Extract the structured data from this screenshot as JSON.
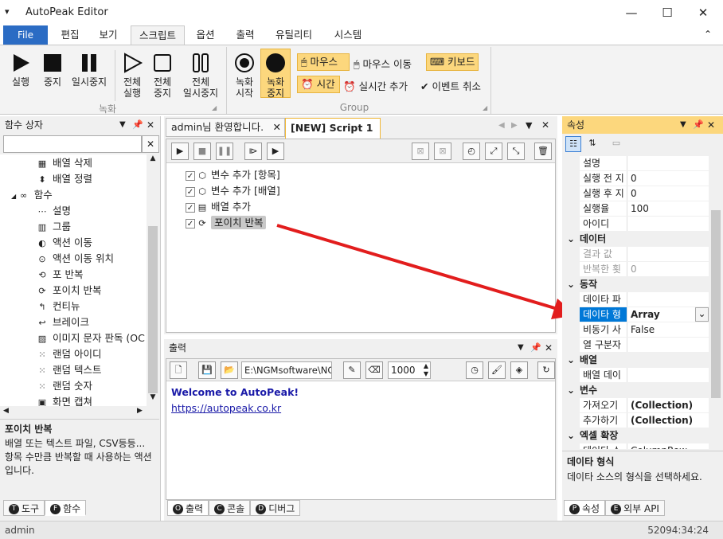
{
  "window": {
    "title": "AutoPeak Editor",
    "menu_glyph": "▾",
    "minimize": "—",
    "maximize": "☐",
    "close": "✕"
  },
  "ribbon_tabs": [
    "File",
    "편집",
    "보기",
    "스크립트",
    "옵션",
    "출력",
    "유틸리티",
    "시스템"
  ],
  "collapse_glyph": "⌃",
  "ribbon": {
    "run": "실행",
    "stop": "중지",
    "pause": "일시중지",
    "run_all": "전체\n실행",
    "stop_all": "전체\n중지",
    "pause_all": "전체\n일시중지",
    "group1": "녹화",
    "rec_start": "녹화\n시작",
    "rec_stop": "녹화\n중지",
    "mouse": "마우스",
    "mouse_move": "마우스 이동",
    "keyboard": "키보드",
    "time": "시간",
    "realtime_add": "실시간 추가",
    "event_cancel": "이벤트 취소",
    "group2": "Group"
  },
  "left_panel": {
    "title": "함수 상자",
    "search_placeholder": "",
    "items": [
      {
        "label": "배열 삭제",
        "icon": "▦"
      },
      {
        "label": "배열 정렬",
        "icon": "⬍"
      },
      {
        "label": "함수",
        "icon": "∞",
        "group": true
      },
      {
        "label": "설명",
        "icon": "⋯"
      },
      {
        "label": "그룹",
        "icon": "▥"
      },
      {
        "label": "액션 이동",
        "icon": "◐"
      },
      {
        "label": "액션 이동 위치",
        "icon": "⊙"
      },
      {
        "label": "포 반복",
        "icon": "⟲"
      },
      {
        "label": "포이치 반복",
        "icon": "⟳"
      },
      {
        "label": "컨티뉴",
        "icon": "↰"
      },
      {
        "label": "브레이크",
        "icon": "↩"
      },
      {
        "label": "이미지 문자 판독 (OC",
        "icon": "▨"
      },
      {
        "label": "랜덤 아이디",
        "icon": "⁙"
      },
      {
        "label": "랜덤 텍스트",
        "icon": "⁙"
      },
      {
        "label": "랜덤 숫자",
        "icon": "⁙"
      },
      {
        "label": "화면 캡쳐",
        "icon": "▣"
      }
    ],
    "desc_title": "포이치 반복",
    "desc_text": "배열 또는 텍스트 파일, CSV등등... 항목 수만큼 반복할 때 사용하는 액션입니다.",
    "tabs": [
      {
        "letter": "T",
        "label": "도구"
      },
      {
        "letter": "F",
        "label": "함수"
      }
    ]
  },
  "doc_tabs": [
    "admin님 환영합니다.",
    "[NEW] Script 1"
  ],
  "script_items": [
    {
      "label": "변수 추가 [항목]",
      "icon": "⬡"
    },
    {
      "label": "변수 추가 [배열]",
      "icon": "⬡"
    },
    {
      "label": "배열 추가",
      "icon": "▤"
    },
    {
      "label": "포이치 반복",
      "icon": "⟳",
      "selected": true
    }
  ],
  "output": {
    "title": "출력",
    "path": "E:\\NGMsoftware\\NG",
    "delay": "1000",
    "welcome": "Welcome to AutoPeak!",
    "link": "https://autopeak.co.kr",
    "tabs": [
      {
        "letter": "O",
        "label": "출력"
      },
      {
        "letter": "C",
        "label": "콘솔"
      },
      {
        "letter": "D",
        "label": "디버그"
      }
    ]
  },
  "properties": {
    "title": "속성",
    "rows": [
      {
        "type": "prop",
        "name": "설명",
        "value": ""
      },
      {
        "type": "prop",
        "name": "실행 전 지",
        "value": "0"
      },
      {
        "type": "prop",
        "name": "실행 후 지",
        "value": "0"
      },
      {
        "type": "prop",
        "name": "실행율",
        "value": "100"
      },
      {
        "type": "prop",
        "name": "아이디",
        "value": ""
      },
      {
        "type": "cat",
        "name": "데이터"
      },
      {
        "type": "prop",
        "name": "결과 값",
        "value": "",
        "dim": true
      },
      {
        "type": "prop",
        "name": "반복한 횟",
        "value": "0",
        "dim": true
      },
      {
        "type": "cat",
        "name": "동작"
      },
      {
        "type": "prop",
        "name": "데이타 파",
        "value": ""
      },
      {
        "type": "prop",
        "name": "데이타 형",
        "value": "Array",
        "selected": true
      },
      {
        "type": "prop",
        "name": "비동기 사",
        "value": "False"
      },
      {
        "type": "prop",
        "name": "열 구분자",
        "value": ""
      },
      {
        "type": "cat",
        "name": "배열"
      },
      {
        "type": "prop",
        "name": "배열 데이",
        "value": ""
      },
      {
        "type": "cat",
        "name": "변수"
      },
      {
        "type": "prop",
        "name": "가져오기",
        "value": "(Collection)",
        "bold": true
      },
      {
        "type": "prop",
        "name": "추가하기",
        "value": "(Collection)",
        "bold": true
      },
      {
        "type": "cat",
        "name": "엑셀 확장"
      },
      {
        "type": "prop",
        "name": "데이타 소",
        "value": "ColumnRow"
      }
    ],
    "desc_title": "데이타 형식",
    "desc_text": "데이타 소스의 형식을 선택하세요.",
    "tabs": [
      {
        "letter": "P",
        "label": "속성"
      },
      {
        "letter": "E",
        "label": "외부 API"
      }
    ]
  },
  "status": {
    "user": "admin",
    "time": "52094:34:24"
  },
  "colors": {
    "accent": "#2b6cc4",
    "highlight": "#fcd77d",
    "arrow": "#e21d1d",
    "selected_row": "#0078d7"
  }
}
